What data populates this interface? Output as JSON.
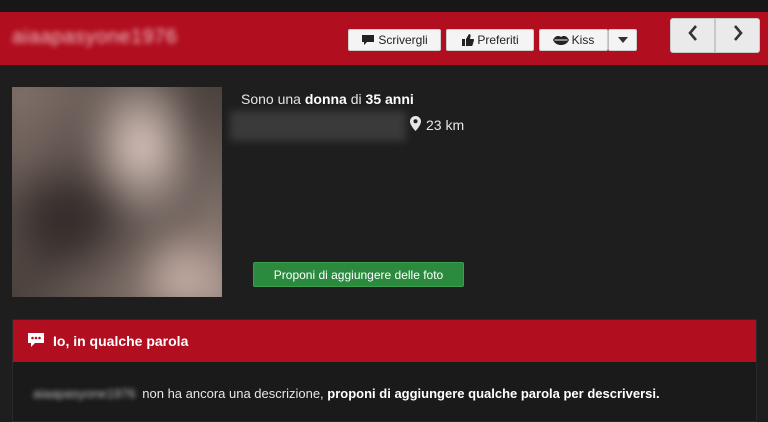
{
  "header": {
    "username": "aiaapasyone1976",
    "buttons": {
      "write": "Scrivergli",
      "favorites": "Preferiti",
      "kiss": "Kiss"
    }
  },
  "profile": {
    "intro_prefix": "Sono una ",
    "gender": "donna",
    "intro_mid": " di ",
    "age": "35 anni",
    "distance": "23 km",
    "propose_photos_label": "Proponi di aggiungere delle foto"
  },
  "about": {
    "title": "Io, in qualche parola",
    "blurred_name": "aiaapasyone1976",
    "text_plain": " non ha ancora una descrizione, ",
    "text_link": "proponi di aggiungere qualche parola per descriversi."
  },
  "colors": {
    "brand_red": "#b10e1f",
    "accent_green": "#2c8a3f",
    "background": "#1e1e1e"
  },
  "icons": [
    "speech-bubble-icon",
    "thumbs-up-icon",
    "lips-icon",
    "caret-down-icon",
    "chevron-left-icon",
    "chevron-right-icon",
    "map-pin-icon",
    "chat-bubbles-icon"
  ]
}
